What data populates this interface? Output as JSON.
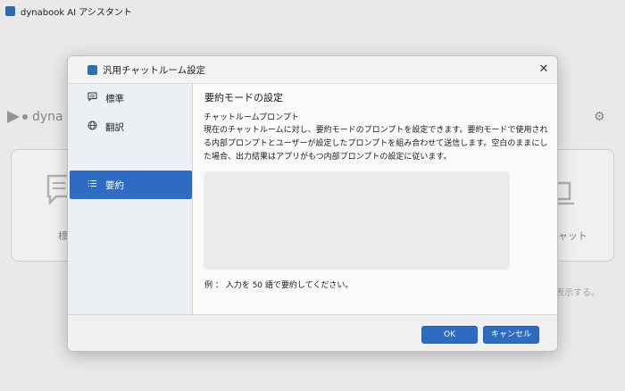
{
  "window": {
    "title": "dynabook AI アシスタント"
  },
  "background": {
    "logo_text": "dyna",
    "left_card_label": "標",
    "right_card_label": "ブチャット",
    "note_text": "接表示する。"
  },
  "dialog": {
    "title": "汎用チャットルーム設定",
    "close_icon": "close-icon",
    "nav_items": [
      {
        "label": "標準",
        "icon": "chat-icon"
      },
      {
        "label": "翻訳",
        "icon": "globe-icon"
      },
      {
        "label": "要約",
        "icon": "list-icon"
      }
    ],
    "active_nav": 2,
    "content": {
      "title": "要約モードの設定",
      "section_label": "チャットルームプロンプト",
      "description": "現在のチャットルームに対し、要約モードのプロンプトを設定できます。要約モードで使用される内部プロンプトとユーザーが設定したプロンプトを組み合わせて送信します。空白のままにした場合、出力結果はアプリがもつ内部プロンプトの設定に従います。",
      "prompt_value": "",
      "example": "例 ： 入力を 50 語で要約してください。"
    },
    "buttons": {
      "ok": "OK",
      "cancel": "キャンセル"
    },
    "accent_color": "#2e6cc4"
  }
}
